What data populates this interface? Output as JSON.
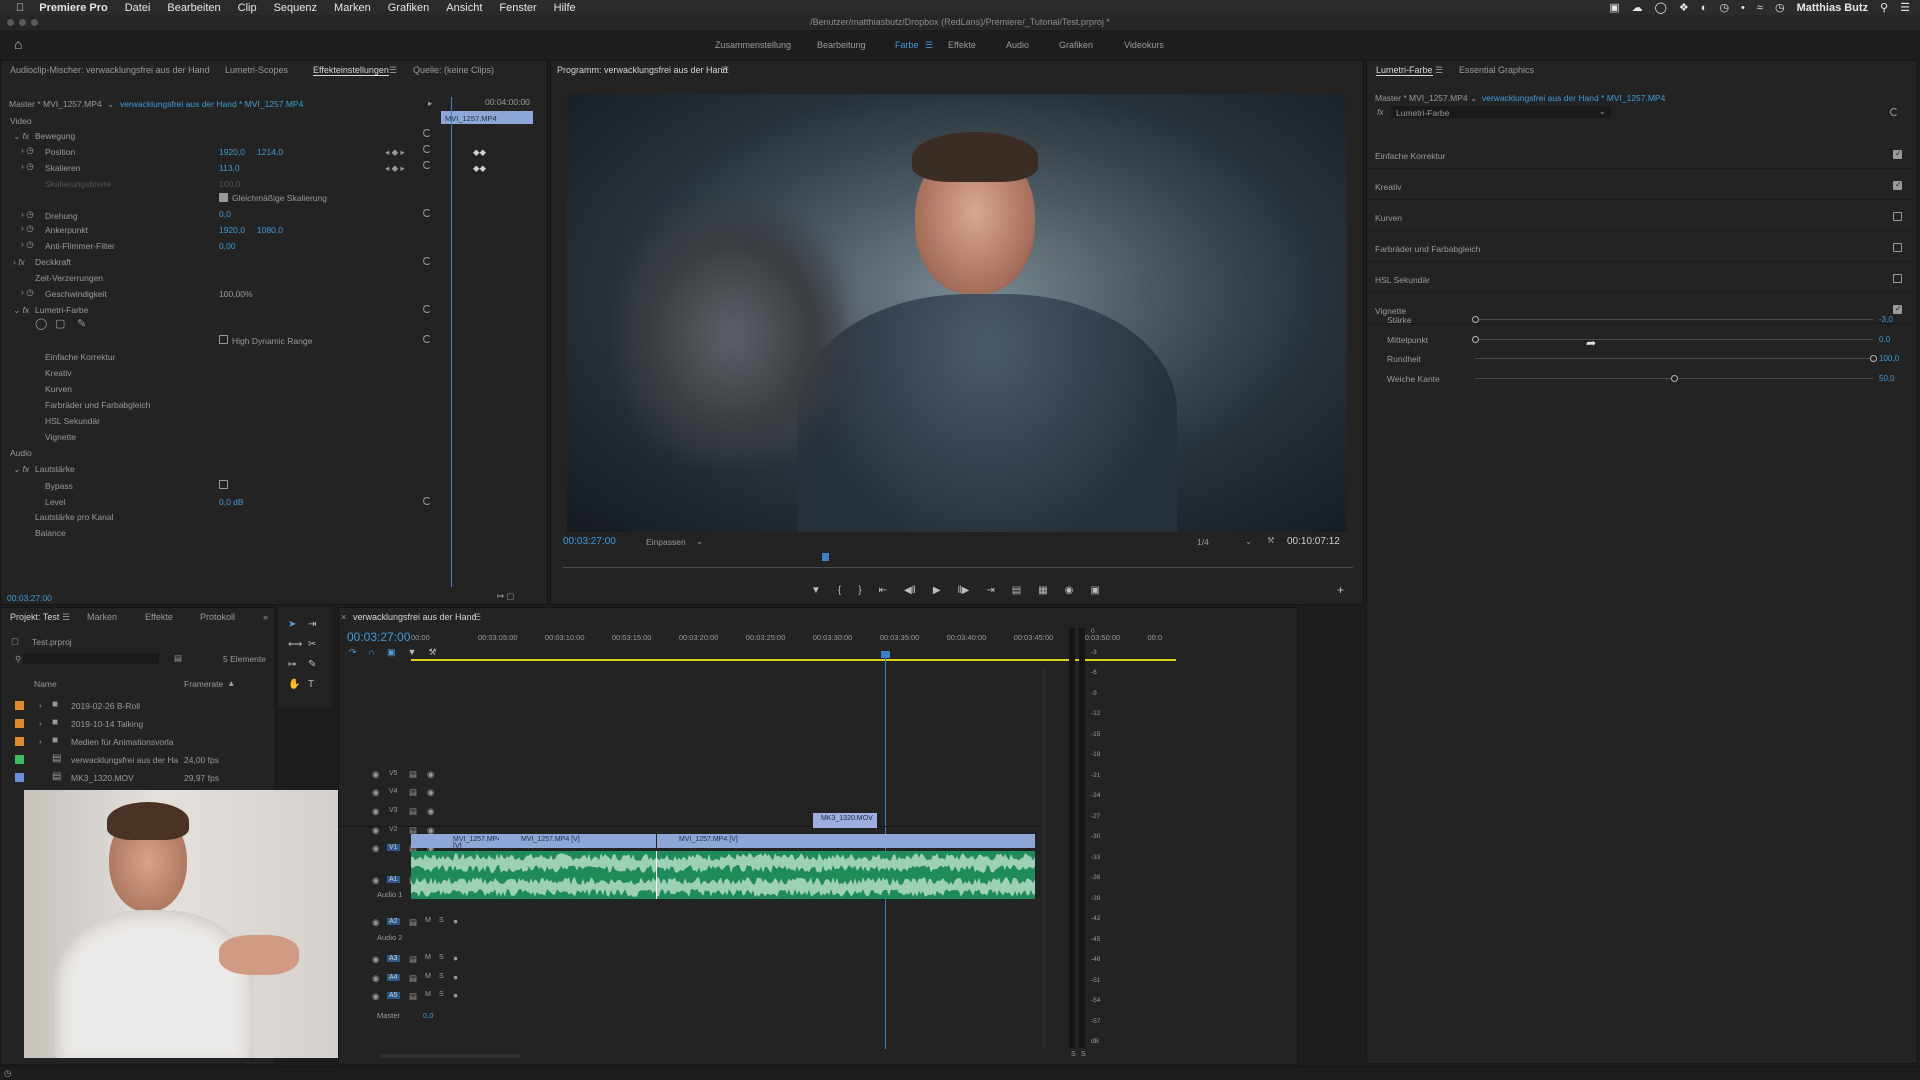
{
  "menubar": {
    "apple": "",
    "app": "Premiere Pro",
    "items": [
      "Datei",
      "Bearbeiten",
      "Clip",
      "Sequenz",
      "Marken",
      "Grafiken",
      "Ansicht",
      "Fenster",
      "Hilfe"
    ],
    "user": "Matthias Butz"
  },
  "titlebar": {
    "path": "/Benutzer/matthiasbutz/Dropbox (RedLans)/Premiere/_Tutorial/Test.prproj *"
  },
  "workspaces": {
    "items": [
      "Zusammenstellung",
      "Bearbeitung",
      "Farbe",
      "Effekte",
      "Audio",
      "Grafiken",
      "Videokurs"
    ],
    "active": "Farbe"
  },
  "effect_panel": {
    "tabs": [
      "Audioclip-Mischer: verwacklungsfrei aus der Hand",
      "Lumetri-Scopes",
      "Effekteinstellungen",
      "Quelle: (keine Clips)"
    ],
    "master": "Master * MVI_1257.MP4",
    "clip_link": "verwacklungsfrei aus der Hand * MVI_1257.MP4",
    "timecode_top": "00:04:00:00",
    "clip_label": "MVI_1257.MP4",
    "video": "Video",
    "bewegung": "Bewegung",
    "position": "Position",
    "pos_x": "1920,0",
    "pos_y": "1214,0",
    "skalieren": "Skalieren",
    "skal_val": "113,0",
    "skal_breite": "Skalierungsbreite",
    "skal_breite_val": "100,0",
    "gleich": "Gleichmäßige Skalierung",
    "drehung": "Drehung",
    "drehung_val": "0,0",
    "anker": "Ankerpunkt",
    "anker_x": "1920,0",
    "anker_y": "1080,0",
    "anti": "Anti-Flimmer-Filter",
    "anti_val": "0,00",
    "deckkraft": "Deckkraft",
    "zeit": "Zeit-Verzerrungen",
    "geschw": "Geschwindigkeit",
    "geschw_val": "100,00%",
    "lumetri": "Lumetri-Farbe",
    "hdr": "High Dynamic Range",
    "einfach": "Einfache Korrektur",
    "kreativ": "Kreativ",
    "kurven": "Kurven",
    "farbrad": "Farbräder und Farbabgleich",
    "hsl": "HSL Sekundär",
    "vignette": "Vignette",
    "audio": "Audio",
    "lautstaerke": "Lautstärke",
    "bypass": "Bypass",
    "level": "Level",
    "level_val": "0,0 dB",
    "lautkanal": "Lautstärke pro Kanal",
    "balance": "Balance",
    "timecode_bottom": "00:03:27:00"
  },
  "program": {
    "title": "Programm: verwacklungsfrei aus der Hand",
    "timecode": "00:03:27:00",
    "fit": "Einpassen",
    "quality": "1/4",
    "duration": "00:10:07:12"
  },
  "lumetri_panel": {
    "tabs": [
      "Lumetri-Farbe",
      "Essential Graphics"
    ],
    "master": "Master * MVI_1257.MP4",
    "clip_link": "verwacklungsfrei aus der Hand * MVI_1257.MP4",
    "fx": "Lumetri-Farbe",
    "sections": [
      {
        "label": "Einfache Korrektur",
        "checked": true
      },
      {
        "label": "Kreativ",
        "checked": true
      },
      {
        "label": "Kurven",
        "checked": false
      },
      {
        "label": "Farbräder und Farbabgleich",
        "checked": false
      },
      {
        "label": "HSL Sekundär",
        "checked": false
      },
      {
        "label": "Vignette",
        "checked": true
      }
    ],
    "sliders": [
      {
        "label": "Stärke",
        "value": "-3,0",
        "fraction": 0.0
      },
      {
        "label": "Mittelpunkt",
        "value": "0,0",
        "fraction": 0.0
      },
      {
        "label": "Rundheit",
        "value": "100,0",
        "fraction": 1.0
      },
      {
        "label": "Weiche Kante",
        "value": "50,0",
        "fraction": 0.5
      }
    ]
  },
  "project_panel": {
    "tabs": [
      "Projekt: Test",
      "Marken",
      "Effekte",
      "Protokoll"
    ],
    "file": "Test.prproj",
    "count": "5 Elemente",
    "col_name": "Name",
    "col_rate": "Framerate",
    "items": [
      {
        "name": "2019-02-26 B-Roll",
        "rate": "",
        "color": "#e08a2e"
      },
      {
        "name": "2019-10-14 Talking",
        "rate": "",
        "color": "#e08a2e"
      },
      {
        "name": "Medien für Animationsvorla",
        "rate": "",
        "color": "#e08a2e"
      },
      {
        "name": "verwacklungsfrei aus der Ha",
        "rate": "24,00 fps",
        "color": "#3dbb5d"
      },
      {
        "name": "MK3_1320.MOV",
        "rate": "29,97 fps",
        "color": "#6b8fd6"
      }
    ]
  },
  "timeline": {
    "title": "verwacklungsfrei aus der Hand",
    "timecode": "00:03:27:00",
    "ruler": [
      "00:00",
      "00:03:05:00",
      "00:03:10:00",
      "00:03:15:00",
      "00:03:20:00",
      "00:03:25:00",
      "00:03:30:00",
      "00:03:35:00",
      "00:03:40:00",
      "00:03:45:00",
      "00:03:50:00",
      "00:0"
    ],
    "video_tracks": [
      "V5",
      "V4",
      "V3",
      "V2",
      "V1"
    ],
    "audio_tracks": [
      "A1",
      "A2",
      "A3",
      "A4",
      "A5"
    ],
    "audio1": "Audio 1",
    "audio2": "Audio 2",
    "master": "Master",
    "master_val": "0,0",
    "clips": [
      "MVI_1257.MP4 [V]",
      "MVI_1257.MP4 [V]",
      "MVI_1257.MP4 [V]"
    ],
    "adjust_clip": "MK3_1320.MOV"
  },
  "meter": {
    "ticks": [
      "0",
      "-3",
      "-6",
      "-9",
      "-12",
      "-15",
      "-18",
      "-21",
      "-24",
      "-27",
      "-30",
      "-33",
      "-36",
      "-39",
      "-42",
      "-45",
      "-48",
      "-51",
      "-54",
      "-57",
      "dB"
    ],
    "sm": [
      "S",
      "S"
    ]
  }
}
